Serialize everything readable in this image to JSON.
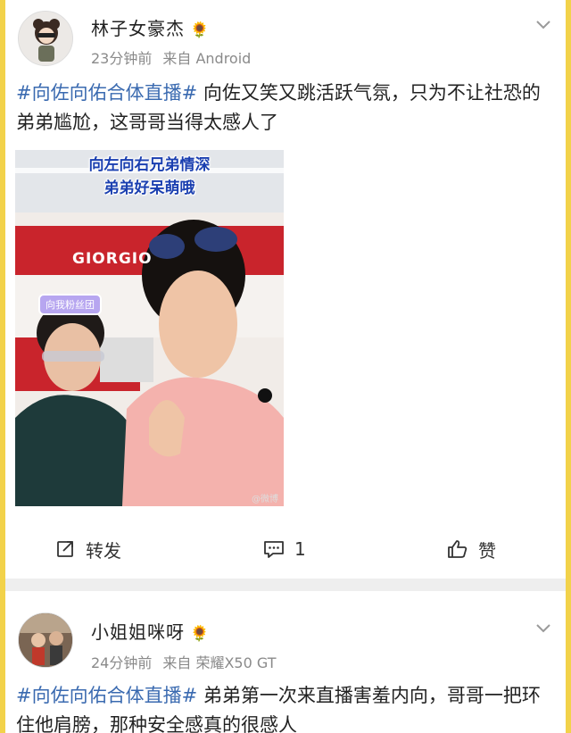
{
  "posts": [
    {
      "username": "林子女豪杰",
      "badge": "🌻",
      "time": "23分钟前",
      "source": "来自 Android",
      "hashtag": "#向佐向佑合体直播#",
      "body": " 向佐又笑又跳活跃气氛，只为不让社恐的弟弟尴尬，这哥哥当得太感人了",
      "media": {
        "caption_line1": "向左向右兄弟情深",
        "caption_line2": "弟弟好呆萌哦",
        "store_sign": "GIORGIO",
        "sticker": "向我粉丝团",
        "watermark": "@微博"
      },
      "actions": {
        "repost_label": "转发",
        "comment_count": "1",
        "like_label": "赞"
      }
    },
    {
      "username": "小姐姐咪呀",
      "badge": "🌻",
      "time": "24分钟前",
      "source": "来自 荣耀X50 GT",
      "hashtag": "#向佐向佑合体直播#",
      "body": " 弟弟第一次来直播害羞内向，哥哥一把环住他肩膀，那种安全感真的很感人"
    }
  ],
  "colors": {
    "hashtag": "#3a6ab0",
    "border": "#f2d24a",
    "meta": "#8a8a8a"
  }
}
